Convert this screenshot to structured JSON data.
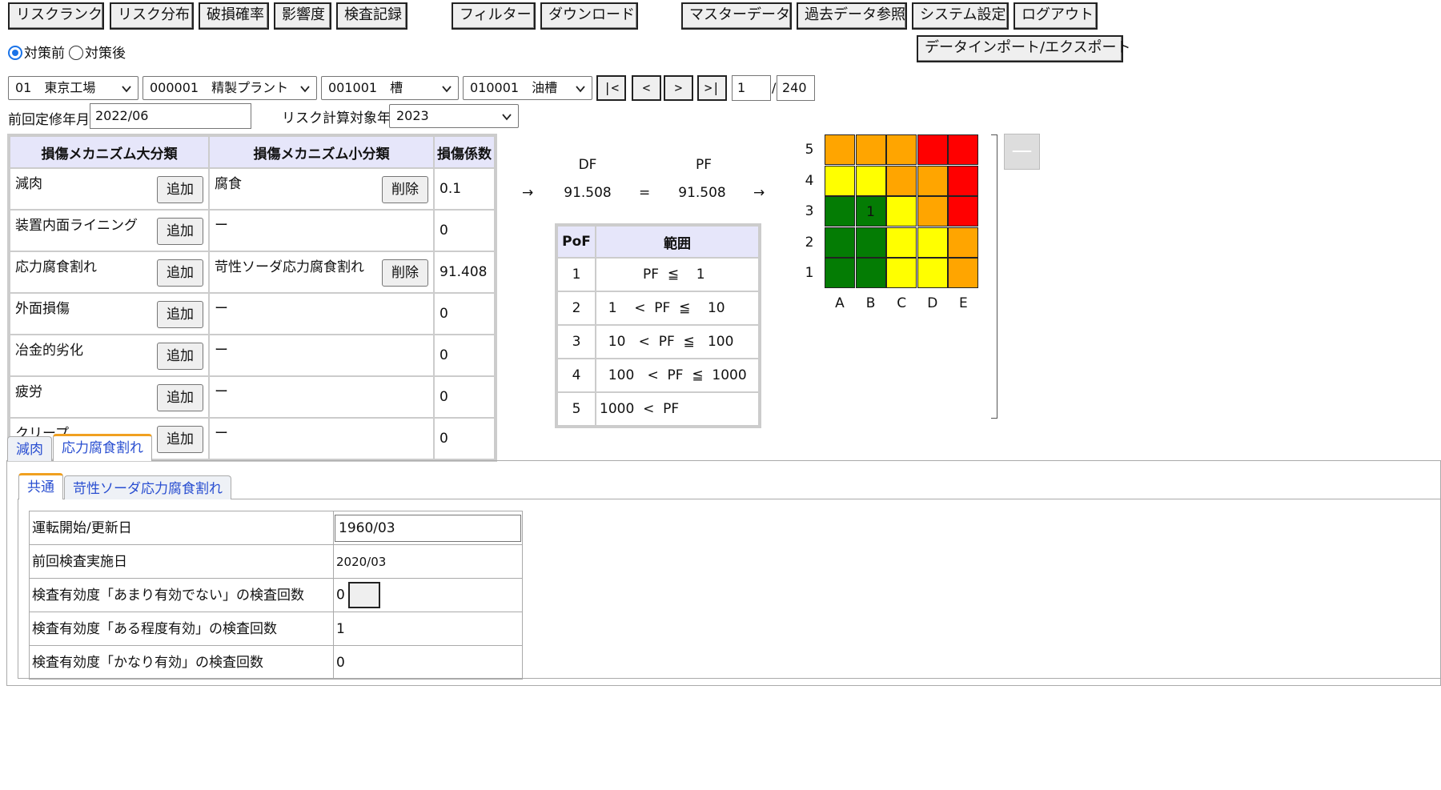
{
  "toolbar": {
    "risk_rank": "リスクランク",
    "risk_dist": "リスク分布",
    "damage_prob": "破損確率",
    "impact": "影響度",
    "inspection": "検査記録",
    "filter": "フィルター",
    "download": "ダウンロード",
    "master": "マスターデータ",
    "past_data": "過去データ参照",
    "sys_settings": "システム設定",
    "logout": "ログアウト",
    "import_export": "データインポート/エクスポート"
  },
  "mode": {
    "before": "対策前",
    "after": "対策後",
    "selected": "before"
  },
  "selectors": {
    "factory": "01　東京工場",
    "plant": "000001　精製プラント",
    "equipment_type": "001001　槽",
    "equipment": "010001　油槽"
  },
  "pager": {
    "first": "|<",
    "prev": "<",
    "next": ">",
    "last": ">|",
    "current": "1",
    "sep": "/",
    "total": "240"
  },
  "revision": {
    "label": "前回定修年月",
    "value": "2022/06"
  },
  "calc_year": {
    "label": "リスク計算対象年",
    "value": "2023"
  },
  "damage_table": {
    "headers": [
      "損傷メカニズム大分類",
      "損傷メカニズム小分類",
      "損傷係数"
    ],
    "add_label": "追加",
    "delete_label": "削除",
    "rows": [
      {
        "major": "減肉",
        "minor": "腐食",
        "has_delete": true,
        "factor": "0.1"
      },
      {
        "major": "装置内面ライニング",
        "minor": "ー",
        "has_delete": false,
        "factor": "0"
      },
      {
        "major": "応力腐食割れ",
        "minor": "苛性ソーダ応力腐食割れ",
        "has_delete": true,
        "factor": "91.408"
      },
      {
        "major": "外面損傷",
        "minor": "ー",
        "has_delete": false,
        "factor": "0"
      },
      {
        "major": "冶金的劣化",
        "minor": "ー",
        "has_delete": false,
        "factor": "0"
      },
      {
        "major": "疲労",
        "minor": "ー",
        "has_delete": false,
        "factor": "0"
      },
      {
        "major": "クリープ",
        "minor": "ー",
        "has_delete": false,
        "factor": "0"
      }
    ]
  },
  "calc": {
    "df_label": "DF",
    "df_value": "91.508",
    "eq": "=",
    "pf_label": "PF",
    "pf_value": "91.508",
    "arrow": "→"
  },
  "pof_table": {
    "headers": [
      "PoF",
      "範囲"
    ],
    "rows": [
      {
        "n": "1",
        "range": "          PF  ≦    1"
      },
      {
        "n": "2",
        "range": "  1    <  PF  ≦    10"
      },
      {
        "n": "3",
        "range": "  10   <  PF  ≦   100"
      },
      {
        "n": "4",
        "range": "  100   <  PF  ≦  1000"
      },
      {
        "n": "5",
        "range": "1000  <  PF"
      }
    ]
  },
  "risk_matrix": {
    "y_labels": [
      "5",
      "4",
      "3",
      "2",
      "1"
    ],
    "x_labels": [
      "A",
      "B",
      "C",
      "D",
      "E"
    ],
    "colors": {
      "G": "#047c04",
      "Y": "#ffff00",
      "O": "#ffa500",
      "R": "#ff0000"
    },
    "grid": [
      [
        "O",
        "O",
        "O",
        "R",
        "R"
      ],
      [
        "Y",
        "Y",
        "O",
        "O",
        "R"
      ],
      [
        "G",
        "G",
        "Y",
        "O",
        "R"
      ],
      [
        "G",
        "G",
        "Y",
        "Y",
        "O"
      ],
      [
        "G",
        "G",
        "Y",
        "Y",
        "O"
      ]
    ],
    "marks": [
      {
        "row": 2,
        "col": 1,
        "count": "1"
      }
    ],
    "minus_label": "—"
  },
  "tabs": {
    "outer": [
      "減肉",
      "応力腐食割れ"
    ],
    "outer_active": 1,
    "inner": [
      "共通",
      "苛性ソーダ応力腐食割れ"
    ],
    "inner_active": 0
  },
  "details": {
    "start_label": "運転開始/更新日",
    "start_value": "1960/03",
    "last_insp_label": "前回検査実施日",
    "last_insp_value": "2020/03",
    "ineff_label": "検査有効度「あまり有効でない」の検査回数",
    "ineff_value": "0",
    "some_label": "検査有効度「ある程度有効」の検査回数",
    "some_value": "1",
    "eff_label": "検査有効度「かなり有効」の検査回数",
    "eff_value": "0"
  }
}
